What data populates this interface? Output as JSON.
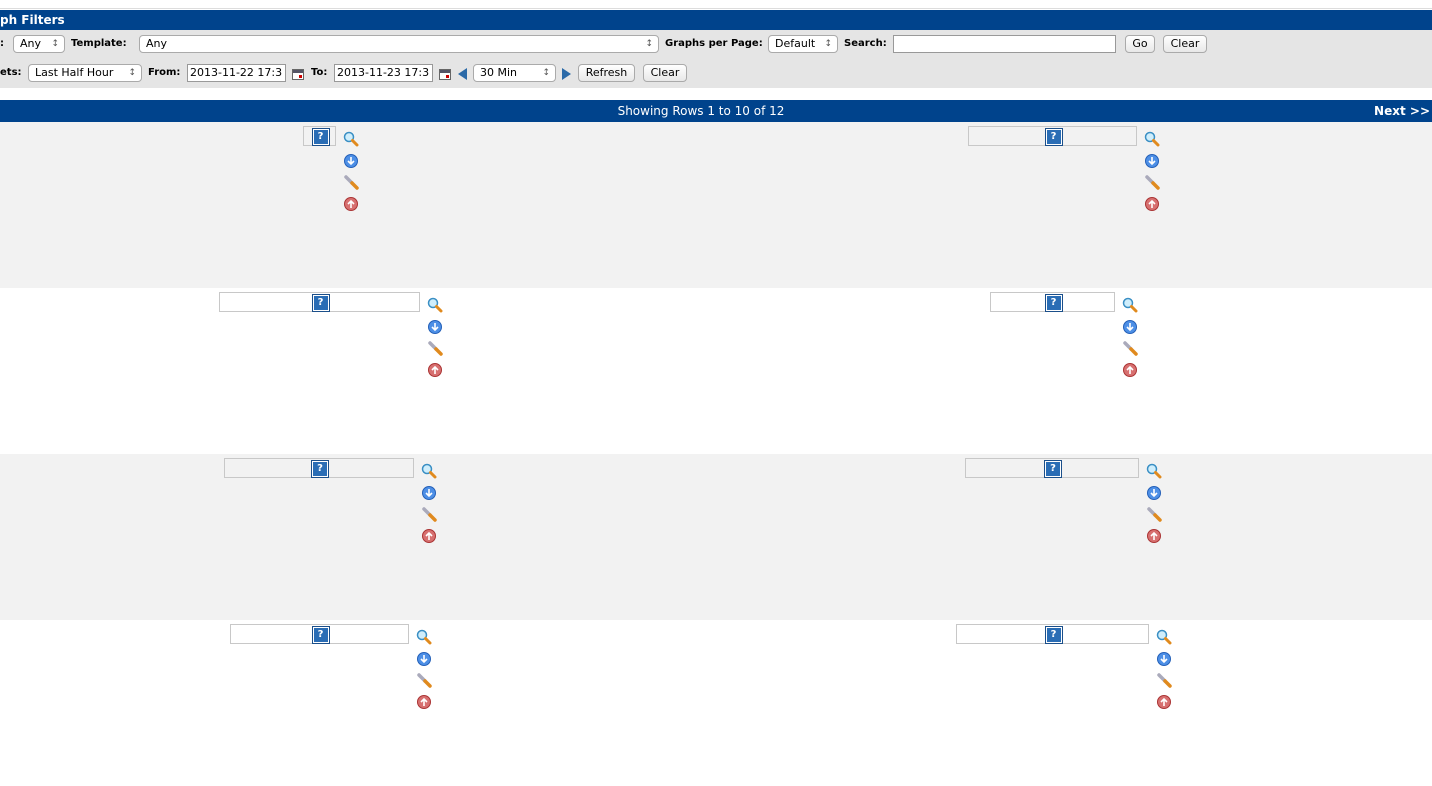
{
  "header": {
    "title": "ph Filters"
  },
  "filters": {
    "host_label": ":",
    "host_value": "Any",
    "template_label": "Template:",
    "template_value": "Any",
    "graphs_per_page_label": "Graphs per Page:",
    "graphs_per_page_value": "Default",
    "search_label": "Search:",
    "search_value": "",
    "search_placeholder": "",
    "go_label": "Go",
    "clear_label": "Clear",
    "presets_label": "ets:",
    "presets_value": "Last Half Hour",
    "from_label": "From:",
    "from_value": "2013-11-22 17:3",
    "to_label": "To:",
    "to_value": "2013-11-23 17:3",
    "timespan_value": "30 Min",
    "refresh_label": "Refresh",
    "clear2_label": "Clear"
  },
  "nav": {
    "showing": "Showing Rows 1 to 10 of 12",
    "next": "Next >>"
  },
  "graph_placeholder": "?",
  "icons": [
    "zoom-icon",
    "export-icon",
    "properties-icon",
    "move-up-icon"
  ],
  "colors": {
    "header": "#00438c",
    "row_alt": "#f2f2f2"
  }
}
